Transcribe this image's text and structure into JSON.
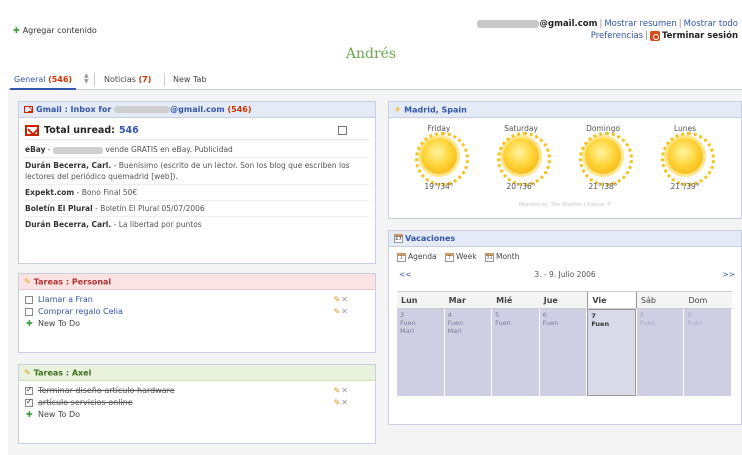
{
  "header": {
    "add_content": "Agregar contenido",
    "email_suffix": "@gmail.com",
    "links": [
      "Mostrar resumen",
      "Mostrar todo"
    ],
    "preferences": "Preferencias",
    "sign_out": "Terminar sesión",
    "page_title": "Andrés"
  },
  "tabs": [
    {
      "label": "General",
      "count": "(546)"
    },
    {
      "label": "Noticias",
      "count": "(7)"
    },
    {
      "label": "New Tab",
      "count": ""
    }
  ],
  "gmail": {
    "title_prefix": "Gmail : Inbox for",
    "title_suffix": "@gmail.com",
    "title_count": "(546)",
    "total_label": "Total unread:",
    "total_value": "546",
    "messages": [
      {
        "from": "eBay",
        "text": "vende GRATIS en eBay. Publicidad"
      },
      {
        "from": "Durán Becerra, Carl.",
        "text": "Buenísimo (escrito de un lector. Son los blog que escriben los lectores del periódico quemadrid [web])."
      },
      {
        "from": "Expekt.com",
        "text": "Bono Final 50€"
      },
      {
        "from": "Boletín El Plural",
        "text": "Boletín El Plural 05/07/2006"
      },
      {
        "from": "Durán Becerra, Carl.",
        "text": "La libertad por puntos"
      }
    ]
  },
  "tareas_personal": {
    "title": "Tareas : Personal",
    "items": [
      {
        "label": "Llamar a Fran",
        "done": false
      },
      {
        "label": "Comprar regalo Celia",
        "done": false
      }
    ],
    "new_label": "New To Do"
  },
  "tareas_axel": {
    "title": "Tareas : Axel",
    "items": [
      {
        "label": "Terminar diseño artículo hardware",
        "done": true
      },
      {
        "label": "artículo servicios online",
        "done": true
      }
    ],
    "new_label": "New To Do"
  },
  "weather": {
    "title": "Madrid, Spain",
    "days": [
      {
        "name": "Friday",
        "temp": "19°/34°",
        "icon": "sunny-icon"
      },
      {
        "name": "Saturday",
        "temp": "20°/36°",
        "icon": "sunny-icon"
      },
      {
        "name": "Domingo",
        "temp": "21°/38°",
        "icon": "sunny-icon"
      },
      {
        "name": "Lunes",
        "temp": "21°/39°",
        "icon": "sunny-icon"
      }
    ],
    "powered_by": "Powered by: The Weather Channel ®"
  },
  "calendar": {
    "title": "Vacaciones",
    "views": [
      "Agenda",
      "Week",
      "Month"
    ],
    "prev": "<<",
    "next": ">>",
    "range": "3. - 9. Julio 2006",
    "day_names": [
      "Lun",
      "Mar",
      "Mié",
      "Jue",
      "Vie",
      "Sáb",
      "Dom"
    ],
    "days": [
      {
        "num": "3",
        "events": [
          "Fuen",
          "Mari"
        ]
      },
      {
        "num": "4",
        "events": [
          "Fuen",
          "Mari"
        ]
      },
      {
        "num": "5",
        "events": [
          "Fuen"
        ]
      },
      {
        "num": "6",
        "events": [
          "Fuen"
        ]
      },
      {
        "num": "7",
        "events": [
          "Fuen"
        ]
      },
      {
        "num": "8",
        "events": [
          "Fuen"
        ]
      },
      {
        "num": "9",
        "events": [
          "Fuen"
        ]
      }
    ]
  },
  "colors": {
    "accent": "#3355aa",
    "title_green": "#6aa84f",
    "count_red": "#cc3300"
  }
}
